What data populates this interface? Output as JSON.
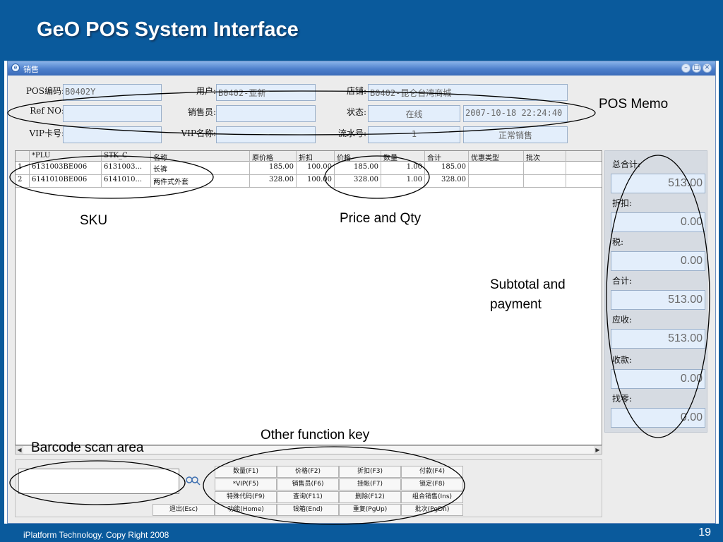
{
  "slide": {
    "title": "GeO POS System Interface",
    "footer": "iPlatform Technology. Copy Right  2008",
    "page_number": "19"
  },
  "window": {
    "title": "销售",
    "controls": [
      "minimize",
      "maximize",
      "close"
    ]
  },
  "header": {
    "pos_code_label": "POS编码:",
    "pos_code": "B0402Y",
    "user_label": "用户:",
    "user": "B0402-亚新",
    "store_label": "店铺:",
    "store": "B0402-昆仑台湾商城",
    "ref_no_label": "Ref NO:",
    "ref_no": "",
    "salesperson_label": "销售员:",
    "salesperson": "",
    "status_label": "状态:",
    "status": "在线",
    "datetime": "2007-10-18 22:24:40",
    "vip_card_label": "VIP卡号:",
    "vip_card": "",
    "vip_name_label": "VIP名称:",
    "vip_name": "",
    "serial_label": "流水号:",
    "serial": "1",
    "sale_mode": "正常销售"
  },
  "grid": {
    "columns": [
      "",
      "*PLU",
      "STK_C",
      "名称",
      "原价格",
      "折扣",
      "价格",
      "数量",
      "合计",
      "优惠类型",
      "批次"
    ],
    "rows": [
      [
        "1",
        "6131003BE006",
        "6131003...",
        "长裤",
        "185.00",
        "100.00",
        "185.00",
        "1.00",
        "185.00",
        "",
        ""
      ],
      [
        "2",
        "6141010BE006",
        "6141010...",
        "两件式外套",
        "328.00",
        "100.00",
        "328.00",
        "1.00",
        "328.00",
        "",
        ""
      ]
    ]
  },
  "totals": {
    "items": [
      {
        "label": "总合计:",
        "value": "513.00"
      },
      {
        "label": "折扣:",
        "value": "0.00"
      },
      {
        "label": "税:",
        "value": "0.00"
      },
      {
        "label": "合计:",
        "value": "513.00"
      },
      {
        "label": "应收:",
        "value": "513.00"
      },
      {
        "label": "收款:",
        "value": "0.00"
      },
      {
        "label": "找零:",
        "value": "0.00"
      }
    ]
  },
  "scan": {
    "value": ""
  },
  "function_keys": [
    [
      "数量(F1)",
      "价格(F2)",
      "折扣(F3)",
      "付款(F4)"
    ],
    [
      "*VIP(F5)",
      "销售员(F6)",
      "挂帐(F7)",
      "锁定(F8)"
    ],
    [
      "特殊代码(F9)",
      "查询(F11)",
      "删除(F12)",
      "组合销售(Ins)"
    ],
    [
      "退出(Esc)",
      "功能(Home)",
      "钱箱(End)",
      "重复(PgUp)",
      "批次(PgDn)"
    ]
  ],
  "annotations": {
    "pos_memo": "POS Memo",
    "sku": "SKU",
    "price_qty": "Price and Qty",
    "subtotal_line1": "Subtotal and",
    "subtotal_line2": "payment",
    "function_key": "Other function key",
    "barcode": "Barcode scan area"
  },
  "colors": {
    "slide_blue": "#0a5a9c",
    "titlebar": "#4d7fcb",
    "field_bg": "#e3eefb",
    "annotation_stroke": "#000000"
  }
}
